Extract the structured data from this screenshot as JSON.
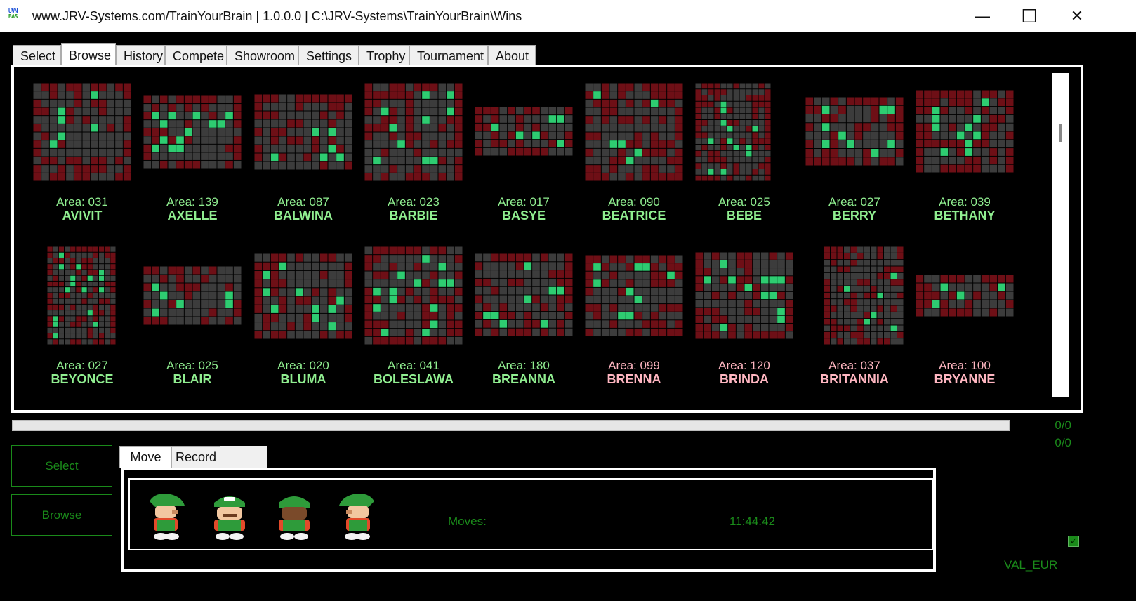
{
  "window": {
    "title": "www.JRV-Systems.com/TrainYourBrain | 1.0.0.0 | C:\\JRV-Systems\\TrainYourBrain\\Wins",
    "icon_text": [
      "UVN",
      "BAS"
    ],
    "controls": {
      "minimize": "—",
      "maximize": "☐",
      "close": "✕"
    }
  },
  "tabs": [
    "Select",
    "Browse",
    "History",
    "Compete",
    "Showroom",
    "Settings",
    "Trophy",
    "Tournament",
    "About"
  ],
  "active_tab": "Browse",
  "levels": [
    {
      "area": "Area: 031",
      "name": "AVIVIT",
      "status": "green"
    },
    {
      "area": "Area: 139",
      "name": "AXELLE",
      "status": "green"
    },
    {
      "area": "Area: 087",
      "name": "BALWINA",
      "status": "green"
    },
    {
      "area": "Area: 023",
      "name": "BARBIE",
      "status": "green"
    },
    {
      "area": "Area: 017",
      "name": "BASYE",
      "status": "green"
    },
    {
      "area": "Area: 090",
      "name": "BEATRICE",
      "status": "green"
    },
    {
      "area": "Area: 025",
      "name": "BEBE",
      "status": "green"
    },
    {
      "area": "Area: 027",
      "name": "BERRY",
      "status": "green"
    },
    {
      "area": "Area: 039",
      "name": "BETHANY",
      "status": "green"
    },
    {
      "area": "Area: 027",
      "name": "BEYONCE",
      "status": "green"
    },
    {
      "area": "Area: 025",
      "name": "BLAIR",
      "status": "green"
    },
    {
      "area": "Area: 020",
      "name": "BLUMA",
      "status": "green"
    },
    {
      "area": "Area: 041",
      "name": "BOLESLAWA",
      "status": "green"
    },
    {
      "area": "Area: 180",
      "name": "BREANNA",
      "status": "green"
    },
    {
      "area": "Area: 099",
      "name": "BRENNA",
      "status": "pink"
    },
    {
      "area": "Area: 120",
      "name": "BRINDA",
      "status": "pink"
    },
    {
      "area": "Area: 037",
      "name": "BRITANNIA",
      "status": "pink"
    },
    {
      "area": "Area: 100",
      "name": "BRYANNE",
      "status": "pink"
    }
  ],
  "counters": [
    "0/0",
    "0/0"
  ],
  "side_buttons": {
    "select": "Select",
    "browse": "Browse"
  },
  "subtabs": [
    "Move",
    "Record"
  ],
  "active_subtab": "Move",
  "move_panel": {
    "moves_label": "Moves:",
    "time": "11:44:42"
  },
  "val_label": "VAL_EUR",
  "colors": {
    "background": "#000000",
    "wall": "#6e0f16",
    "floor": "#3c3c3c",
    "box": "#2ecc71",
    "solved_label": "#90ee90",
    "unsolved_label": "#ffb6c1",
    "accent": "#1a8a1a"
  }
}
